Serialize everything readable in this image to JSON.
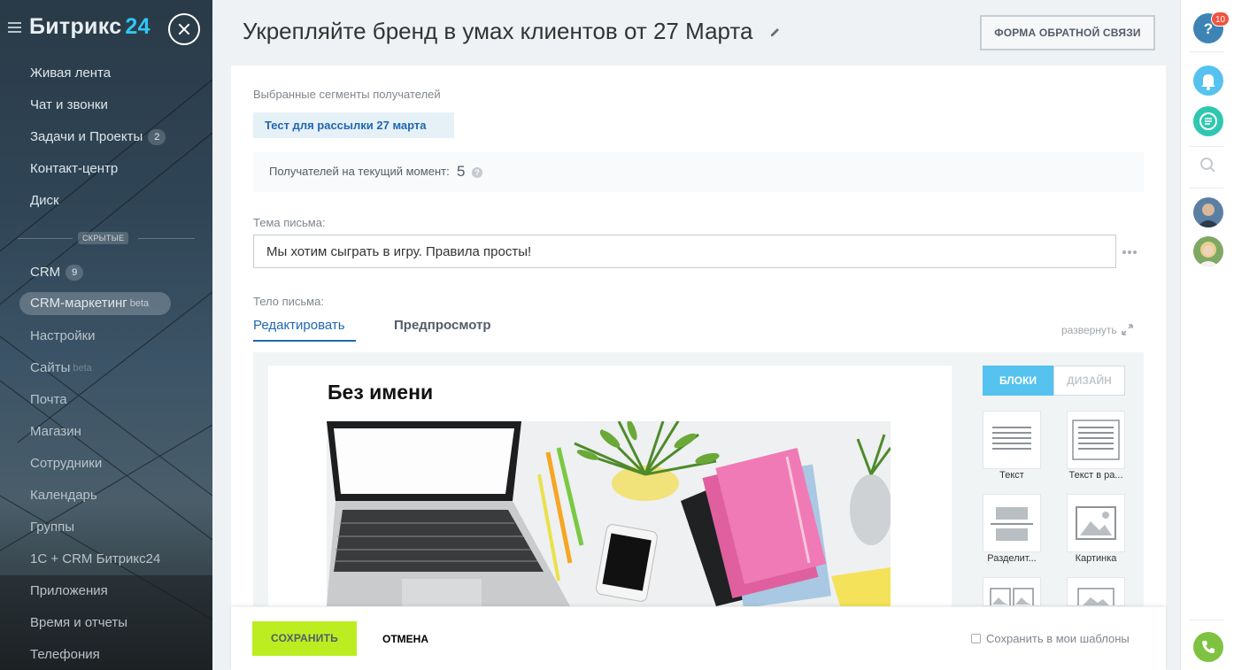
{
  "sidebar": {
    "brand_name": "Битрикс",
    "brand_num": "24",
    "items": [
      {
        "label": "Живая лента"
      },
      {
        "label": "Чат и звонки"
      },
      {
        "label": "Задачи и Проекты",
        "counter": "2"
      },
      {
        "label": "Контакт-центр"
      },
      {
        "label": "Диск"
      },
      {
        "label": "CRM",
        "counter": "9"
      },
      {
        "label": "CRM-маркетинг",
        "suffix": "beta"
      },
      {
        "label": "Настройки"
      },
      {
        "label": "Сайты",
        "suffix": "beta"
      },
      {
        "label": "Почта"
      },
      {
        "label": "Магазин"
      },
      {
        "label": "Сотрудники"
      },
      {
        "label": "Календарь"
      },
      {
        "label": "Группы"
      },
      {
        "label": "1С + CRM Битрикс24"
      },
      {
        "label": "Приложения"
      },
      {
        "label": "Время и отчеты"
      },
      {
        "label": "Телефония"
      }
    ],
    "hidden_label": "СКРЫТЫЕ"
  },
  "header": {
    "title": "Укрепляйте бренд в умах клиентов от 27 Марта",
    "feedback_button": "ФОРМА ОБРАТНОЙ СВЯЗИ"
  },
  "form": {
    "segments_label": "Выбранные сегменты получателей",
    "segment_chip": "Тест для рассылки 27 марта",
    "recipients_label": "Получателей на текущий момент:",
    "recipients_count": "5",
    "subject_label": "Тема письма:",
    "subject_value": "Мы хотим сыграть в игру. Правила просты!",
    "body_label": "Тело письма:",
    "tabs": {
      "edit": "Редактировать",
      "preview": "Предпросмотр"
    },
    "expand_label": "развернуть"
  },
  "editor": {
    "letter_title": "Без имени",
    "mode_blocks": "БЛОКИ",
    "mode_design": "ДИЗАЙН",
    "blocks": [
      {
        "label": "Текст"
      },
      {
        "label": "Текст в ра..."
      },
      {
        "label": "Разделит..."
      },
      {
        "label": "Картинка"
      }
    ]
  },
  "footer": {
    "save": "СОХРАНИТЬ",
    "cancel": "ОТМЕНА",
    "save_template": "Сохранить в мои шаблоны"
  },
  "rail": {
    "help_badge": "10"
  },
  "colors": {
    "accent_blue": "#2067b0",
    "save_green": "#bbed21",
    "rail_blue": "#55c2ef",
    "rail_teal": "#2fc7b0",
    "phone_green": "#7fc242",
    "badge_red": "#f0533f"
  }
}
